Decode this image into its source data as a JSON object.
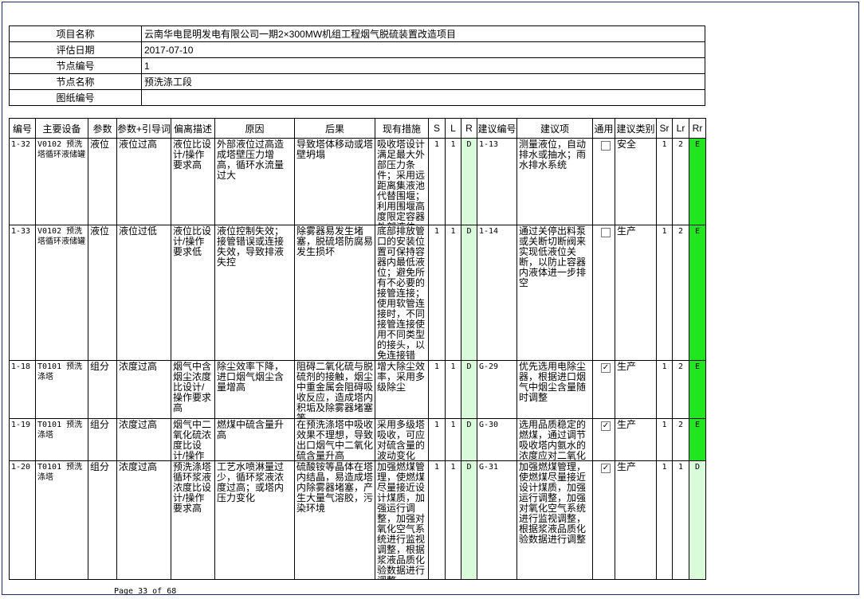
{
  "info": [
    {
      "label": "项目名称",
      "value": "云南华电昆明发电有限公司一期2×300MW机组工程烟气脱硫装置改造项目"
    },
    {
      "label": "评估日期",
      "value": "2017-07-10"
    },
    {
      "label": "节点编号",
      "value": "1"
    },
    {
      "label": "节点名称",
      "value": "预洗涤工段"
    },
    {
      "label": "图纸编号",
      "value": ""
    }
  ],
  "headers": [
    "编号",
    "主要设备",
    "参数",
    "参数+引导词",
    "偏离描述",
    "原因",
    "后果",
    "现有措施",
    "S",
    "L",
    "R",
    "建议编号",
    "建议项",
    "通用",
    "建议类别",
    "Sr",
    "Lr",
    "Rr"
  ],
  "rows": [
    {
      "id": "1-32",
      "device": "V0102 预洗塔循环液储罐",
      "param": "液位",
      "guide": "液位过高",
      "dev": "液位比设计/操作要求高",
      "cause": "外部液位过高造成塔壁压力增高，循环水流量过大",
      "conseq": "导致塔体移动或塔壁坍塌",
      "measure": "吸收塔设计满足最大外部压力条件；采用远距离集液池代替围堰；利用围堰高度限定容器外部液位。",
      "s": "1",
      "l": "1",
      "r": "D",
      "sug_id": "1-13",
      "suggest": "测量液位，自动排水或抽水；雨水排水系统",
      "common": false,
      "category": "安全",
      "sr": "1",
      "lr": "2",
      "rr": "E"
    },
    {
      "id": "1-33",
      "device": "V0102 预洗塔循环液储罐",
      "param": "液位",
      "guide": "液位过低",
      "dev": "液位比设计/操作要求低",
      "cause": "液位控制失效；接管错误或连接失效，导致排液失控",
      "conseq": "除雾器易发生堵塞，脱硫塔防腐易发生损坏",
      "measure": "底部排放管口的安装位置可保持容器内最低液位；避免所有不必要的接管连接；使用软管连接时，不同接管连接使用不同类型的接头，以免连接错误。",
      "s": "1",
      "l": "1",
      "r": "D",
      "sug_id": "1-14",
      "suggest": "通过关停出料泵或关断切断阀来实现低液位关断，以防止容器内液体进一步排空",
      "common": false,
      "category": "生产",
      "sr": "1",
      "lr": "2",
      "rr": "E"
    },
    {
      "id": "1-18",
      "device": "T0101 预洗涤塔",
      "param": "组分",
      "guide": "浓度过高",
      "dev": "烟气中含烟尘浓度比设计/操作要求高",
      "cause": "除尘效率下降，进口烟气烟尘含量增高",
      "conseq": "阻碍二氧化硫与脱硫剂的接触，烟尘中重金属会阻碍吸收反应，造成塔内积垢及除雾器堵塞等。",
      "measure": "增大除尘效率，采用多级除尘",
      "s": "1",
      "l": "1",
      "r": "D",
      "sug_id": "G-29",
      "suggest": "优先选用电除尘器，根据进口烟气中烟尘含量随时调整",
      "common": true,
      "category": "生产",
      "sr": "1",
      "lr": "2",
      "rr": "E"
    },
    {
      "id": "1-19",
      "device": "T0101 预洗涤塔",
      "param": "组分",
      "guide": "浓度过高",
      "dev": "烟气中二氧化硫浓度比设计/操作要求高",
      "cause": "燃煤中硫含量升高",
      "conseq": "在预洗涤塔中吸收效果不理想，导致出口烟气中二氧化硫含量升高",
      "measure": "采用多级塔吸收，可应对硫含量的波动变化",
      "s": "1",
      "l": "1",
      "r": "D",
      "sug_id": "G-30",
      "suggest": "选用品质稳定的燃煤，通过调节吸收塔内氨水的浓度应对二氧化硫的浓度变化",
      "common": true,
      "category": "生产",
      "sr": "1",
      "lr": "2",
      "rr": "E"
    },
    {
      "id": "1-20",
      "device": "T0101 预洗涤塔",
      "param": "组分",
      "guide": "浓度过高",
      "dev": "预洗涤塔循环浆液浓度比设计/操作要求高",
      "cause": "工艺水喷淋量过少，循环浆液浓度过高；或塔内压力变化",
      "conseq": "硫酸铵等晶体在塔内结晶，易造成塔内除雾器堵塞，产生大量气溶胶，污染环境",
      "measure": "加强燃煤管理，使燃煤尽量接近设计煤质，加强运行调整，加强对氧化空气系统进行监视调整，根据浆液品质化验数据进行调整",
      "s": "1",
      "l": "1",
      "r": "D",
      "sug_id": "G-31",
      "suggest": "加强燃煤管理，使燃煤尽量接近设计煤质，加强运行调整，加强对氧化空气系统进行监视调整，根据浆液品质化验数据进行调整",
      "common": true,
      "category": "生产",
      "sr": "1",
      "lr": "1",
      "rr": "D"
    }
  ],
  "footer": "Page 33 of 68"
}
